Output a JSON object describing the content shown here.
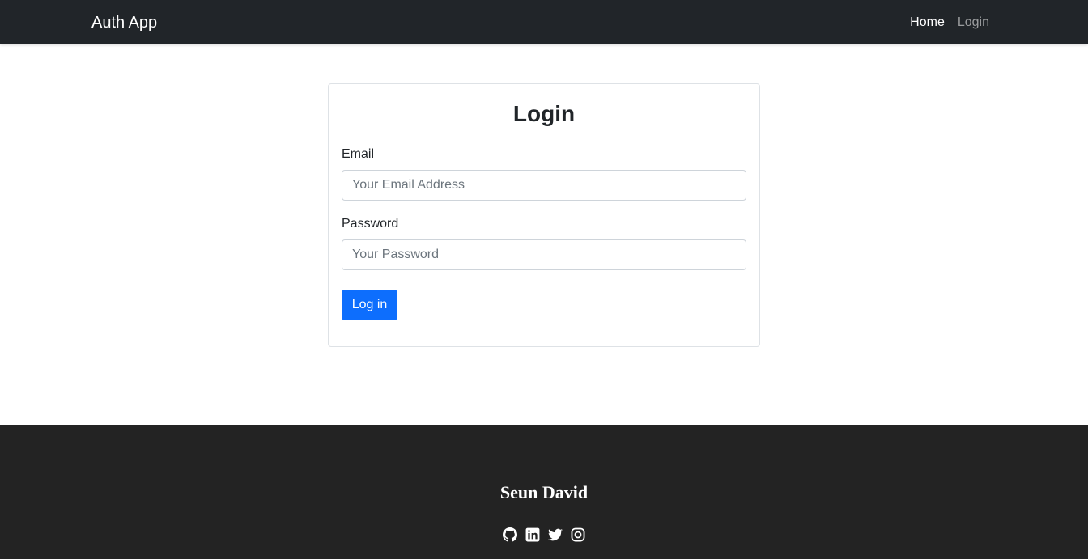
{
  "navbar": {
    "brand": "Auth App",
    "links": [
      {
        "label": "Home",
        "active": true
      },
      {
        "label": "Login",
        "active": false
      }
    ]
  },
  "login_card": {
    "title": "Login",
    "email": {
      "label": "Email",
      "placeholder": "Your Email Address",
      "value": ""
    },
    "password": {
      "label": "Password",
      "placeholder": "Your Password",
      "value": ""
    },
    "submit_label": "Log in"
  },
  "footer": {
    "name": "Seun David",
    "social_icons": [
      "github-icon",
      "linkedin-icon",
      "twitter-icon",
      "instagram-icon"
    ]
  },
  "colors": {
    "navbar_bg": "#212529",
    "primary_button": "#0d6efd",
    "footer_bg": "#232323"
  }
}
